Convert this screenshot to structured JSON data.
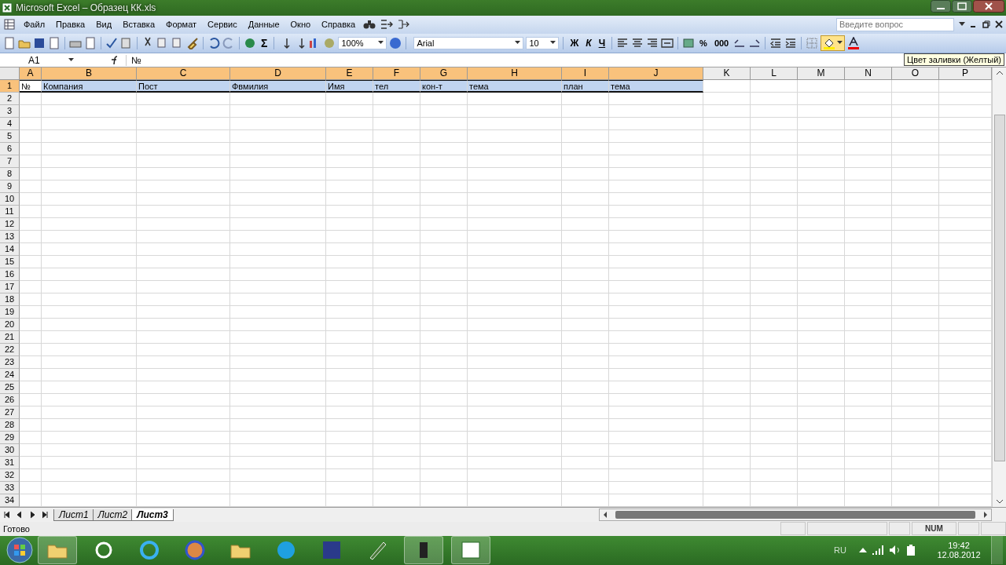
{
  "window": {
    "title": "Microsoft Excel – Образец КК.xls"
  },
  "menu": [
    "Файл",
    "Правка",
    "Вид",
    "Вставка",
    "Формат",
    "Сервис",
    "Данные",
    "Окно",
    "Справка"
  ],
  "help_search": {
    "placeholder": "Введите вопрос"
  },
  "toolbar": {
    "sum_symbol": "Σ",
    "zoom": "100%",
    "font": "Arial",
    "font_size": "10",
    "format_buttons": [
      "Ж",
      "К",
      "Ч"
    ],
    "number_buttons": [
      "%",
      "000"
    ],
    "fill_button_hovered": true,
    "tooltip": "Цвет заливки (Желтый)"
  },
  "name_box": "A1",
  "formula": "№",
  "columns": [
    {
      "letter": "A",
      "selected": true
    },
    {
      "letter": "B",
      "selected": true
    },
    {
      "letter": "C",
      "selected": true
    },
    {
      "letter": "D",
      "selected": true
    },
    {
      "letter": "E",
      "selected": true
    },
    {
      "letter": "F",
      "selected": true
    },
    {
      "letter": "G",
      "selected": true
    },
    {
      "letter": "H",
      "selected": true
    },
    {
      "letter": "I",
      "selected": true
    },
    {
      "letter": "J",
      "selected": true
    },
    {
      "letter": "K",
      "selected": false
    },
    {
      "letter": "L",
      "selected": false
    },
    {
      "letter": "M",
      "selected": false
    },
    {
      "letter": "N",
      "selected": false
    },
    {
      "letter": "O",
      "selected": false
    },
    {
      "letter": "P",
      "selected": false
    }
  ],
  "rows": [
    {
      "number": "1",
      "selected": true,
      "cells": [
        "№",
        "Компания",
        "Пост",
        "Фвмилия",
        "Имя",
        "тел",
        "кон-т",
        "тема",
        "план",
        "тема"
      ]
    },
    {
      "number": "2",
      "selected": false
    },
    {
      "number": "3",
      "selected": false
    },
    {
      "number": "4",
      "selected": false
    },
    {
      "number": "5",
      "selected": false
    },
    {
      "number": "6",
      "selected": false
    },
    {
      "number": "7",
      "selected": false
    },
    {
      "number": "8",
      "selected": false
    },
    {
      "number": "9",
      "selected": false
    },
    {
      "number": "10",
      "selected": false
    },
    {
      "number": "11",
      "selected": false
    },
    {
      "number": "12",
      "selected": false
    },
    {
      "number": "13",
      "selected": false
    },
    {
      "number": "14",
      "selected": false
    },
    {
      "number": "15",
      "selected": false
    },
    {
      "number": "16",
      "selected": false
    },
    {
      "number": "17",
      "selected": false
    },
    {
      "number": "18",
      "selected": false
    },
    {
      "number": "19",
      "selected": false
    },
    {
      "number": "20",
      "selected": false
    },
    {
      "number": "21",
      "selected": false
    },
    {
      "number": "22",
      "selected": false
    },
    {
      "number": "23",
      "selected": false
    },
    {
      "number": "24",
      "selected": false
    },
    {
      "number": "25",
      "selected": false
    },
    {
      "number": "26",
      "selected": false
    },
    {
      "number": "27",
      "selected": false
    },
    {
      "number": "28",
      "selected": false
    },
    {
      "number": "29",
      "selected": false
    },
    {
      "number": "30",
      "selected": false
    },
    {
      "number": "31",
      "selected": false
    },
    {
      "number": "32",
      "selected": false
    },
    {
      "number": "33",
      "selected": false
    },
    {
      "number": "34",
      "selected": false
    }
  ],
  "sheet_tabs": [
    {
      "label": "Лист1",
      "selected": false
    },
    {
      "label": "Лист2",
      "selected": false
    },
    {
      "label": "Лист3",
      "selected": true
    }
  ],
  "status_bar": {
    "text": "Готово",
    "indicator": "NUM"
  },
  "taskbar": {
    "language": "RU",
    "time": "19:42",
    "date": "12.08.2012"
  }
}
